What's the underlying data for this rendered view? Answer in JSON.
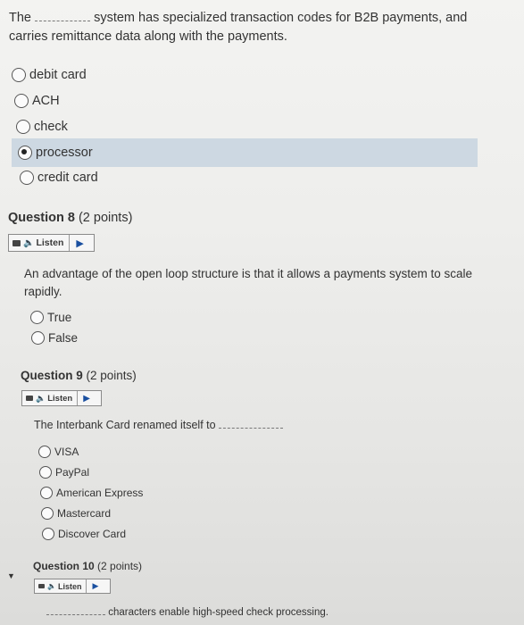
{
  "q7": {
    "text_pre": "The",
    "text_post": "system has specialized transaction codes for B2B payments, and",
    "text_line2": "carries remittance data along with the payments.",
    "options": [
      "debit card",
      "ACH",
      "check",
      "processor",
      "credit card"
    ],
    "selected": "processor"
  },
  "q8": {
    "title": "Question 8",
    "points": "(2 points)",
    "listen": "Listen",
    "text_line1": "An advantage of the open loop structure is that it allows a payments system to scale",
    "text_line2": "rapidly.",
    "options": [
      "True",
      "False"
    ]
  },
  "q9": {
    "title": "Question 9",
    "points": "(2 points)",
    "listen": "Listen",
    "text": "The Interbank Card renamed itself to",
    "options": [
      "VISA",
      "PayPal",
      "American Express",
      "Mastercard",
      "Discover Card"
    ]
  },
  "q10": {
    "title": "Question 10",
    "points": "(2 points)",
    "listen": "Listen",
    "text": "characters enable high-speed check processing."
  },
  "colors": {
    "selected_highlight": "#cdd8e2",
    "play_icon": "#1a4fa0"
  },
  "icons": [
    "radio-button-icon",
    "speaker-icon",
    "play-icon",
    "chevron-down-icon"
  ]
}
